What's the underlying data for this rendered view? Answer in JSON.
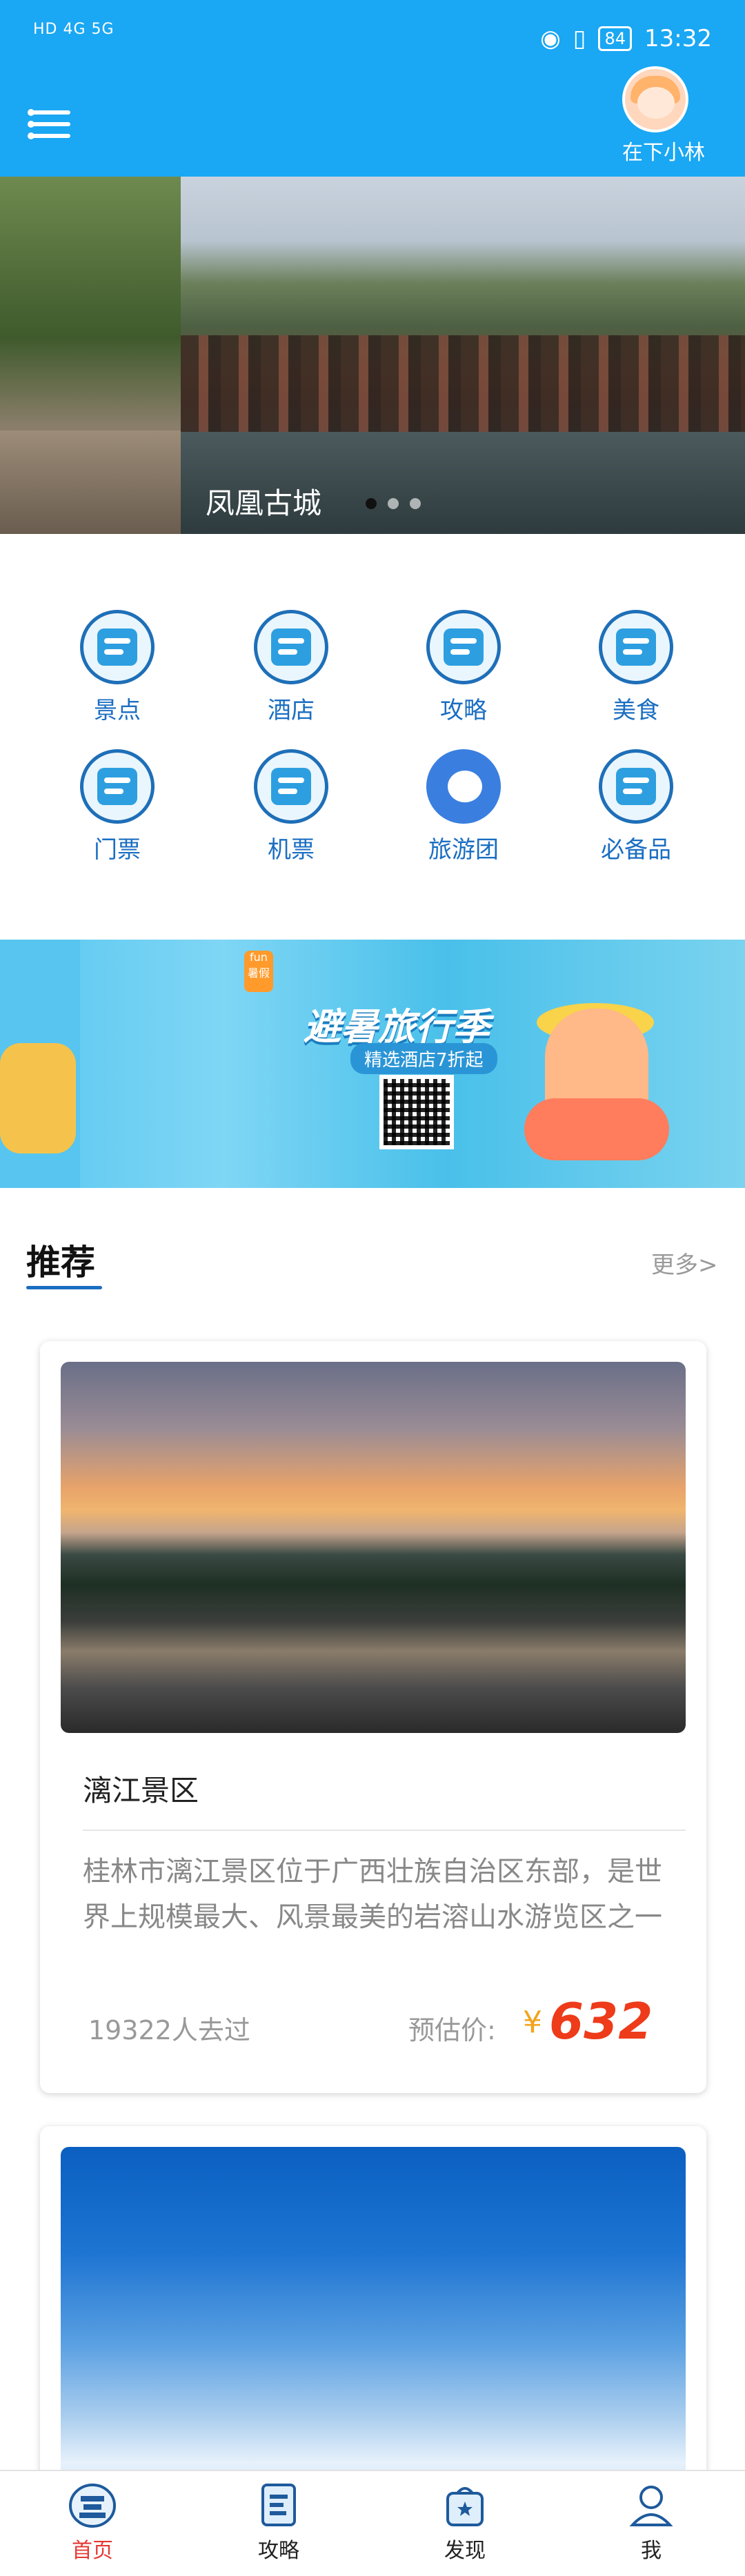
{
  "status_bar": {
    "signal_text": "HD 4G 5G",
    "battery": "84",
    "time": "13:32"
  },
  "header": {
    "username": "在下小林"
  },
  "carousel": {
    "caption": "凤凰古城",
    "active_index": 0,
    "dot_count": 3
  },
  "categories": [
    {
      "label": "景点",
      "icon": "pagoda-icon"
    },
    {
      "label": "酒店",
      "icon": "hotel-icon"
    },
    {
      "label": "攻略",
      "icon": "guide-icon"
    },
    {
      "label": "美食",
      "icon": "food-bowl-icon"
    },
    {
      "label": "门票",
      "icon": "ticket-icon"
    },
    {
      "label": "机票",
      "icon": "airplane-icon"
    },
    {
      "label": "旅游团",
      "icon": "tour-group-icon"
    },
    {
      "label": "必备品",
      "icon": "shop-icon"
    }
  ],
  "promo": {
    "title": "避暑旅行季",
    "subtitle": "精选酒店7折起",
    "badge": "fun 暑假"
  },
  "recommend": {
    "title": "推荐",
    "more": "更多>"
  },
  "cards": [
    {
      "name": "漓江景区",
      "description": "桂林市漓江景区位于广西壮族自治区东部，是世界上规模最大、风景最美的岩溶山水游览区之一",
      "visited": "19322人去过",
      "price_label": "预估价:",
      "currency": "¥",
      "price": "632"
    }
  ],
  "bottom_nav": [
    {
      "label": "首页",
      "icon": "home-pagoda-icon",
      "active": true
    },
    {
      "label": "攻略",
      "icon": "guide-book-icon",
      "active": false
    },
    {
      "label": "发现",
      "icon": "discover-bag-icon",
      "active": false
    },
    {
      "label": "我",
      "icon": "user-icon",
      "active": false
    }
  ],
  "colors": {
    "header_bg": "#1aa7f3",
    "accent_blue": "#1a6ec2",
    "price_red": "#ee3b1a",
    "yen_orange": "#f2a31c",
    "nav_active": "#e53935"
  }
}
